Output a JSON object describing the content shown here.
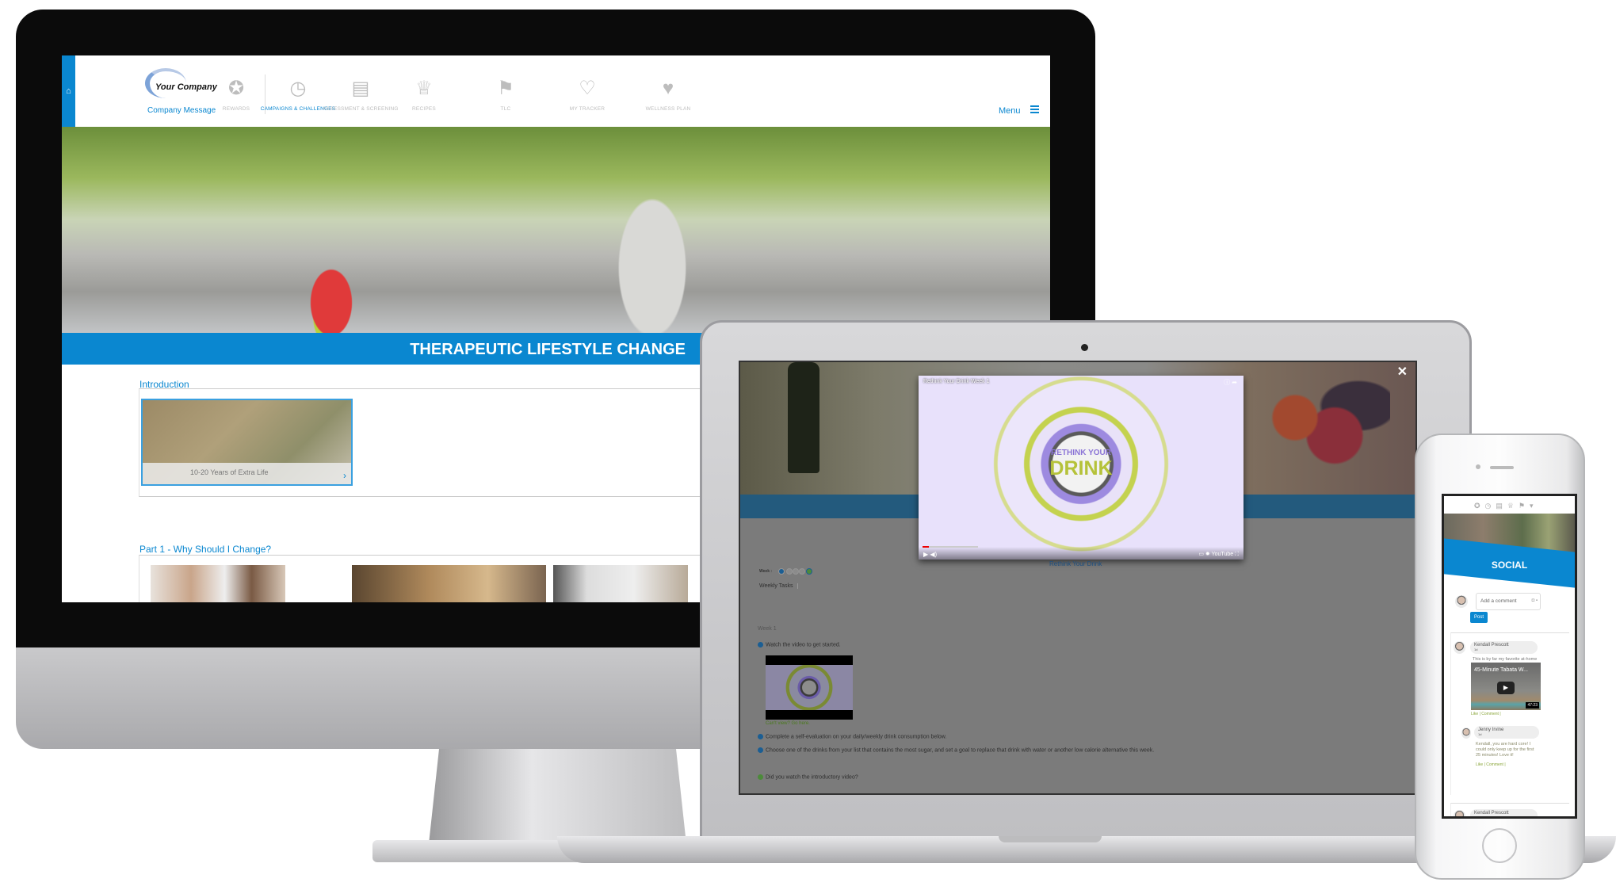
{
  "monitor": {
    "nav": {
      "home_icon": "home-icon",
      "logo_text": "Your Company",
      "company_message": "Company Message",
      "items": [
        {
          "label": "REWARDS",
          "icon": "ribbon-icon",
          "glyph": "✪",
          "active": false
        },
        {
          "label": "CAMPAIGNS & CHALLENGES",
          "icon": "stopwatch-icon",
          "glyph": "◷",
          "active": true
        },
        {
          "label": "ASSESSMENT & SCREENING",
          "icon": "clipboard-icon",
          "glyph": "▤",
          "active": false
        },
        {
          "label": "RECIPES",
          "icon": "chef-hat-icon",
          "glyph": "♕",
          "active": false
        },
        {
          "label": "TLC",
          "icon": "signpost-icon",
          "glyph": "⚑",
          "active": false
        },
        {
          "label": "MY TRACKER",
          "icon": "heartbeat-icon",
          "glyph": "♡",
          "active": false
        },
        {
          "label": "WELLNESS PLAN",
          "icon": "heart-check-icon",
          "glyph": "♥",
          "active": false
        }
      ],
      "menu_label": "Menu"
    },
    "banner_title": "THERAPEUTIC LIFESTYLE CHANGE",
    "sections": [
      {
        "title": "Introduction",
        "cards": [
          {
            "caption": "10-20 Years of Extra Life"
          }
        ]
      },
      {
        "title": "Part 1 - Why Should I Change?"
      }
    ]
  },
  "laptop": {
    "video": {
      "title": "Rethink Your Drink Week 1",
      "brand_line1": "RETHINK YOUR",
      "brand_line2": "DRINK",
      "youtube_label": "YouTube"
    },
    "video_link": "Rethink Your Drink",
    "week_label": "Week :",
    "tab": "Weekly Tasks",
    "week_heading": "Week 1",
    "tasks": [
      "Watch the video to get started.",
      "Complete a self-evaluation on your daily/weekly drink consumption below.",
      "Choose one of the drinks from your list that contains the most sugar, and set a goal to replace that drink with water or another low calorie alternative this week."
    ],
    "cant_view": "Can't view? Go here.",
    "question": "Did you watch the introductory video?",
    "colors": {
      "overlay": "#7b7b7b",
      "band": "#235a7d",
      "brand_purple": "#8b74d6",
      "brand_green": "#b5c23a"
    }
  },
  "phone": {
    "title": "SOCIAL",
    "comment_placeholder": "Add a comment",
    "post_label": "Post",
    "posts": [
      {
        "author": "Kendall Prescott",
        "time": "1d",
        "text": "This is by far my favorite at-home workout.",
        "video_title": "45-Minute Tabata W...",
        "video_duration": "47:23",
        "like": "Like",
        "comment": "Comment",
        "reply": {
          "author": "Jenny Irvine",
          "time": "1d",
          "text": "Kendall, you are hard core! I could only keep up for the first 25 minutes! Love it!",
          "like": "Like",
          "comment": "Comment"
        }
      },
      {
        "author": "Kendall Prescott"
      }
    ]
  },
  "colors": {
    "brand_blue": "#0a87d0"
  }
}
